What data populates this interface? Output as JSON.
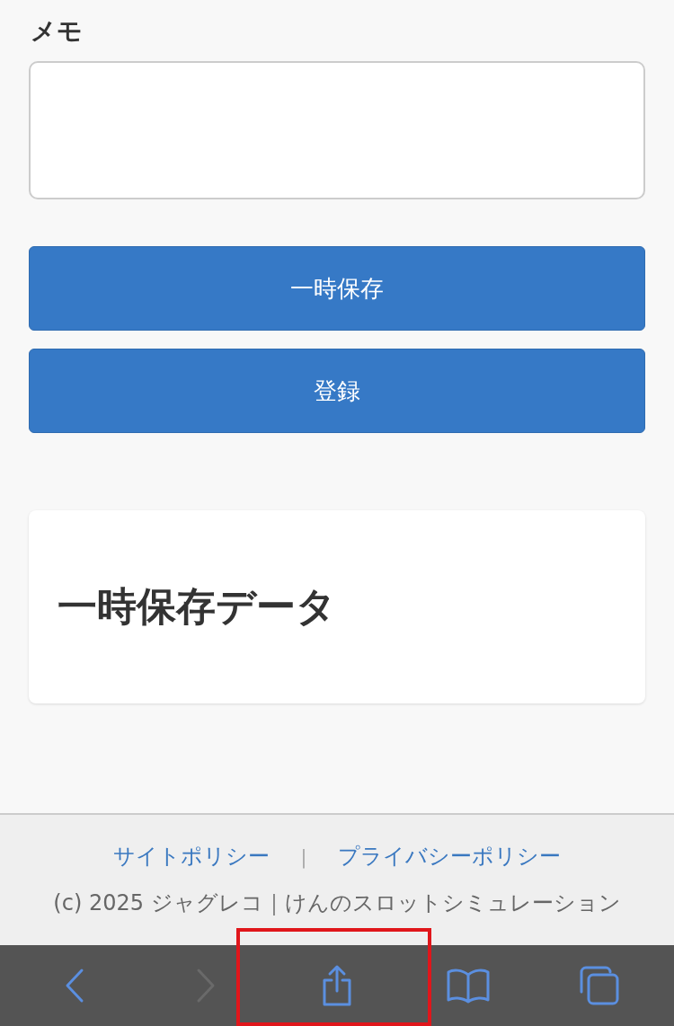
{
  "memo": {
    "label": "メモ"
  },
  "buttons": [
    "一時保存",
    "登録"
  ],
  "saved_card": {
    "title": "一時保存データ"
  },
  "footer": {
    "links": [
      "サイトポリシー",
      "プライバシーポリシー"
    ],
    "separator": "|",
    "copyright": "(c) 2025 ジャグレコ｜けんのスロットシミュレーション"
  },
  "toolbar": {
    "items": [
      {
        "kind": "back",
        "disabled": false
      },
      {
        "kind": "forward",
        "disabled": true
      },
      {
        "kind": "share",
        "disabled": false,
        "highlighted": true
      },
      {
        "kind": "bookmarks",
        "disabled": false
      },
      {
        "kind": "tabs",
        "disabled": false
      }
    ]
  }
}
